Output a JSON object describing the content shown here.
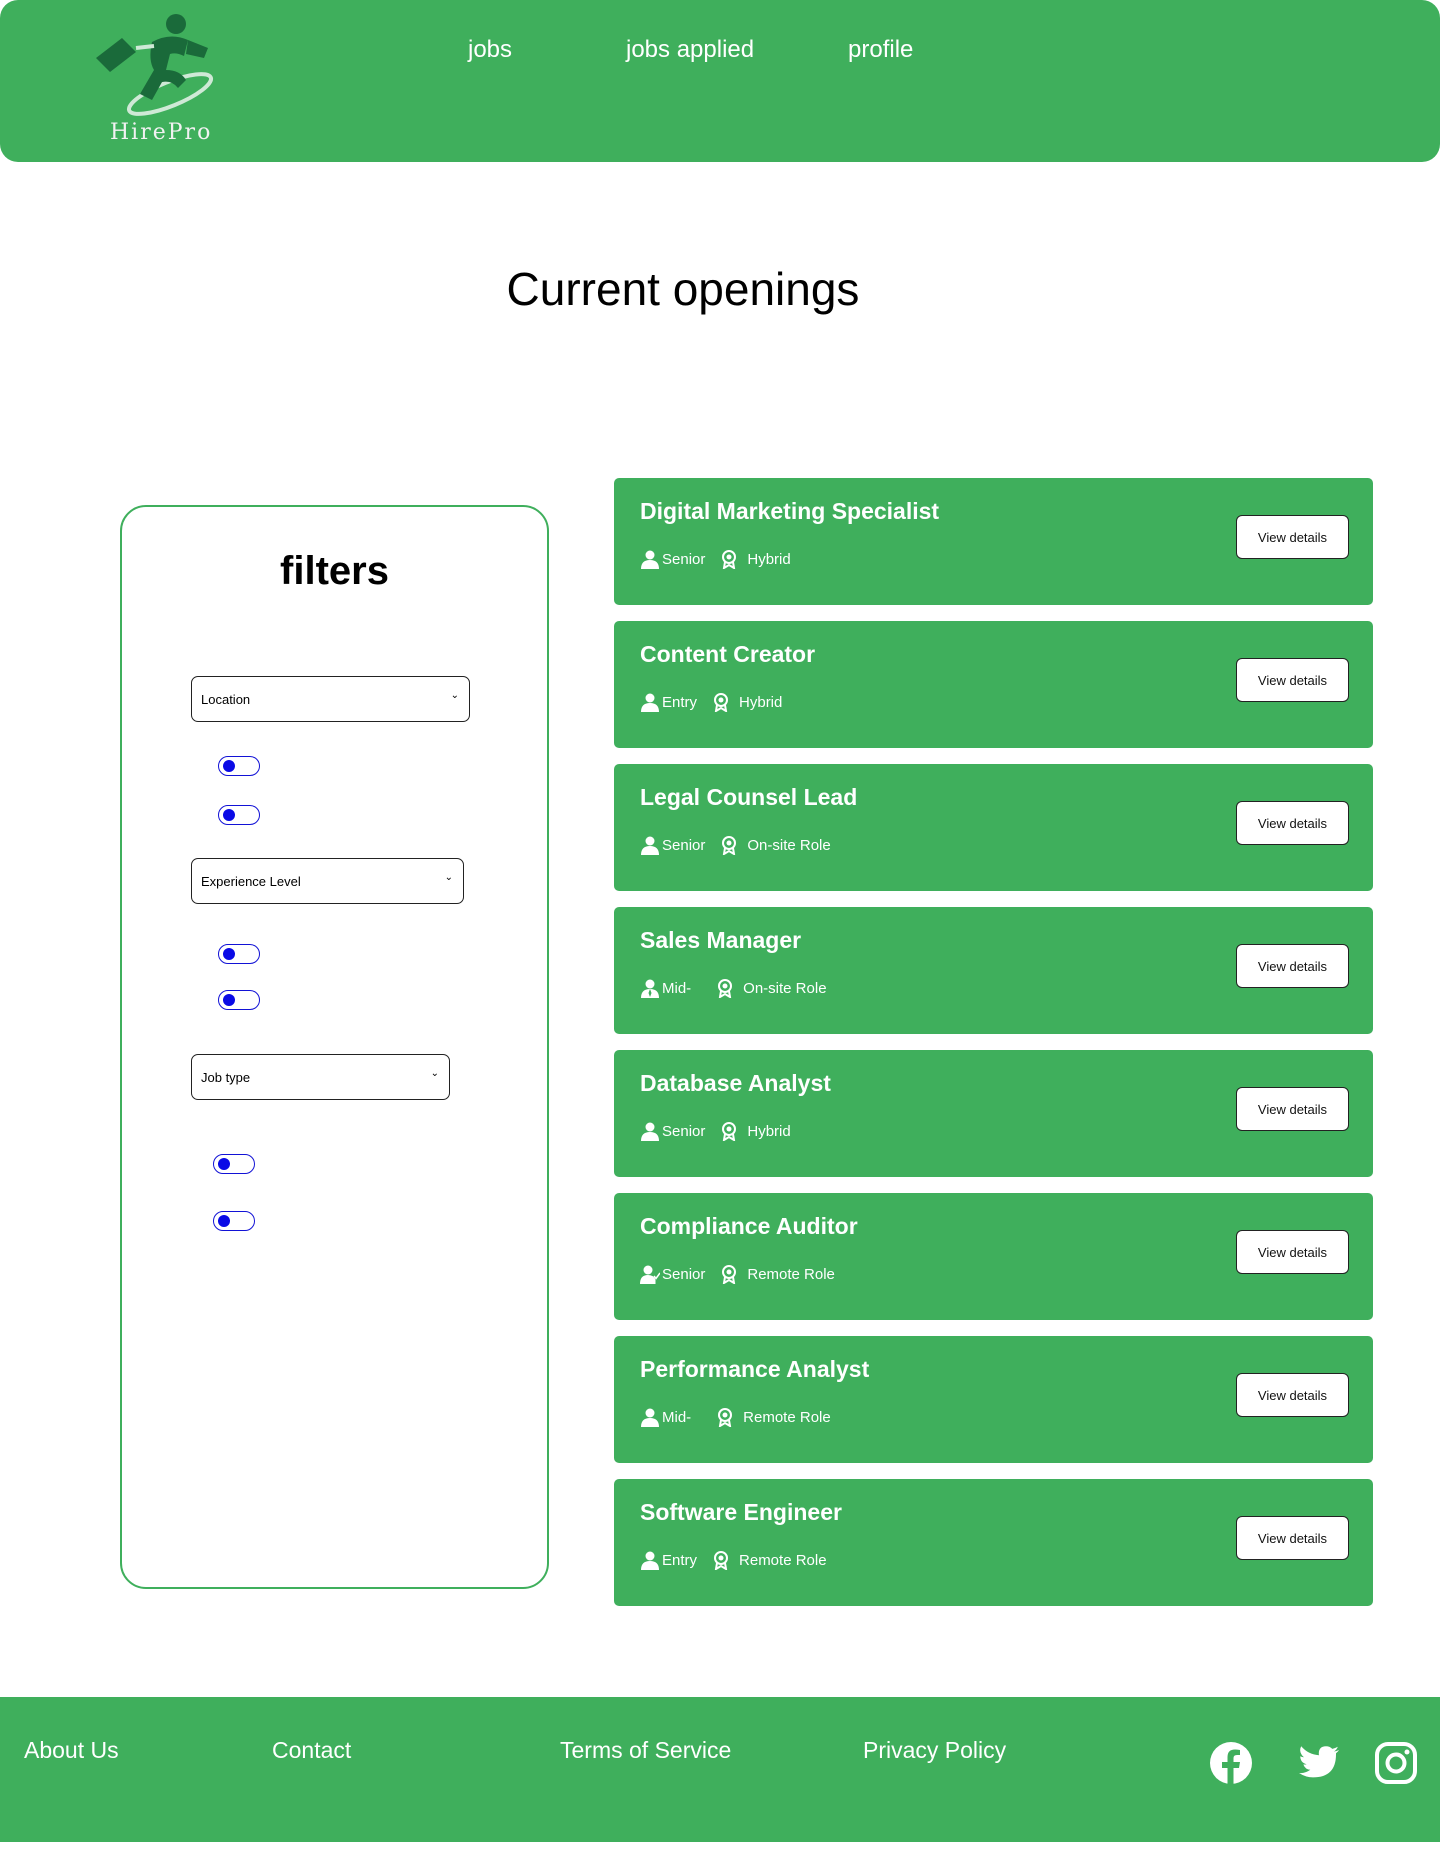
{
  "brand": {
    "name": "HirePro",
    "colors": {
      "primary": "#3faf5c",
      "toggle": "#0a0ae6",
      "logo_dark": "#1a6a3a"
    }
  },
  "nav": {
    "items": [
      {
        "label": "jobs"
      },
      {
        "label": "jobs applied"
      },
      {
        "label": "profile"
      }
    ]
  },
  "main": {
    "title": "Current openings"
  },
  "filters": {
    "title": "filters",
    "selects": [
      {
        "label": "Location",
        "icon": "chevron-down-icon"
      },
      {
        "label": "Experience Level",
        "icon": "chevron-down-icon"
      },
      {
        "label": "Job type",
        "icon": "chevron-down-icon"
      }
    ]
  },
  "jobs": [
    {
      "title": "Digital Marketing Specialist",
      "level": "Senior",
      "mode": "Hybrid",
      "button": "View details"
    },
    {
      "title": "Content Creator",
      "level": "Entry",
      "mode": "Hybrid",
      "button": "View details"
    },
    {
      "title": "Legal Counsel Lead",
      "level": "Senior",
      "mode": "On-site Role",
      "button": "View details"
    },
    {
      "title": "Sales Manager",
      "level": "Mid-",
      "mode": "On-site Role",
      "button": "View details"
    },
    {
      "title": "Database Analyst",
      "level": "Senior",
      "mode": "Hybrid",
      "button": "View details"
    },
    {
      "title": "Compliance Auditor",
      "level": "Senior",
      "mode": "Remote Role",
      "button": "View details"
    },
    {
      "title": "Performance Analyst",
      "level": "Mid-",
      "mode": "Remote Role",
      "button": "View details"
    },
    {
      "title": "Software Engineer",
      "level": "Entry",
      "mode": "Remote Role",
      "button": "View details"
    }
  ],
  "footer": {
    "links": [
      {
        "label": "About Us"
      },
      {
        "label": "Contact"
      },
      {
        "label": "Terms of Service"
      },
      {
        "label": "Privacy Policy"
      }
    ],
    "social": [
      {
        "icon": "facebook-icon"
      },
      {
        "icon": "twitter-icon"
      },
      {
        "icon": "instagram-icon"
      }
    ]
  }
}
